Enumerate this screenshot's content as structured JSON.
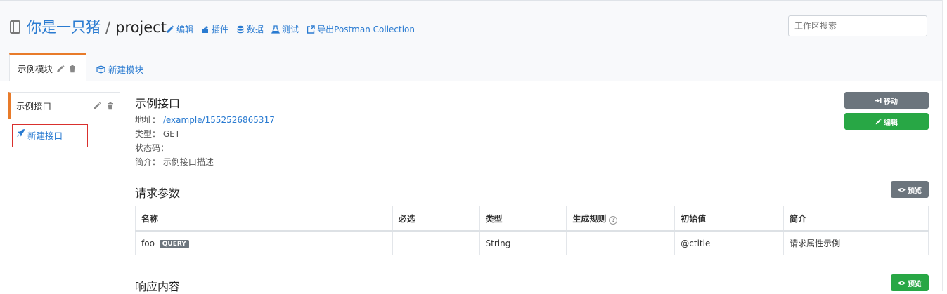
{
  "header": {
    "user": "你是一只猪",
    "separator": "/",
    "project": "project",
    "actions": [
      {
        "label": "编辑",
        "icon": "pencil-icon"
      },
      {
        "label": "插件",
        "icon": "puzzle-icon"
      },
      {
        "label": "数据",
        "icon": "database-icon"
      },
      {
        "label": "测试",
        "icon": "flask-icon"
      },
      {
        "label": "导出Postman Collection",
        "icon": "external-link-icon"
      }
    ],
    "search_placeholder": "工作区搜索"
  },
  "tabs": {
    "active_label": "示例模块",
    "new_module_label": "新建模块"
  },
  "sidebar": {
    "item_label": "示例接口",
    "new_api_label": "新建接口"
  },
  "api": {
    "title": "示例接口",
    "address_label": "地址：",
    "address_value": "/example/1552526865317",
    "type_label": "类型：",
    "type_value": "GET",
    "status_label": "状态码：",
    "status_value": "",
    "desc_label": "简介：",
    "desc_value": "示例接口描述",
    "move_button": "移动",
    "edit_button": "编辑"
  },
  "request": {
    "title": "请求参数",
    "preview_button": "预览",
    "columns": [
      "名称",
      "必选",
      "类型",
      "生成规则",
      "初始值",
      "简介"
    ],
    "rows": [
      {
        "name": "foo",
        "badge": "QUERY",
        "required": "",
        "type": "String",
        "rule": "",
        "initial": "@ctitle",
        "desc": "请求属性示例"
      }
    ]
  },
  "response": {
    "title": "响应内容",
    "preview_button": "预览"
  },
  "colors": {
    "link": "#2a7bd1",
    "accent_orange": "#e87b2a",
    "gray_button": "#6c757d",
    "green_button": "#28a745",
    "highlight_red": "#d9302d"
  }
}
